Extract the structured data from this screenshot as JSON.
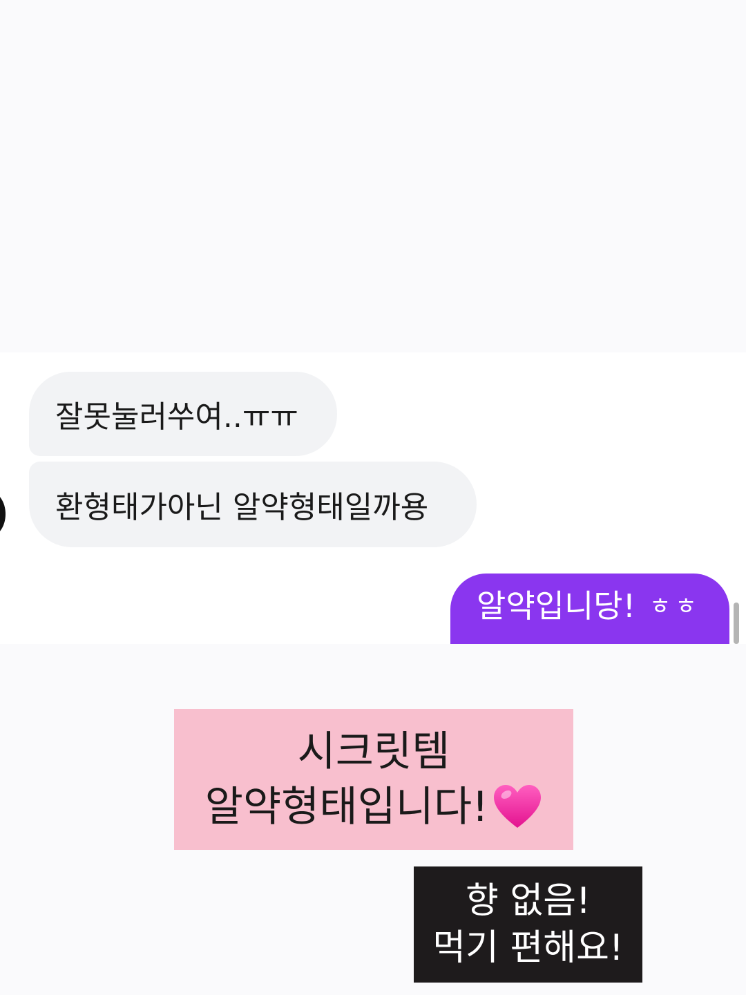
{
  "chat": {
    "messages": [
      {
        "side": "incoming",
        "text": "잘못눌러쑤여..ㅠㅠ"
      },
      {
        "side": "incoming",
        "text": "환형태가아닌 알약형태일까용"
      },
      {
        "side": "outgoing",
        "text": "알약입니당!",
        "laugh": "ㅎㅎ"
      }
    ],
    "colors": {
      "incoming_bubble": "#f2f3f5",
      "outgoing_bubble": "#8a36ef"
    }
  },
  "captions": {
    "pink": {
      "line1": "시크릿템",
      "line2": "알약형태입니다!",
      "icon": "pink-heart-icon",
      "background": "#f8bfce"
    },
    "dark": {
      "line1": "향 없음!",
      "line2": "먹기 편해요!",
      "background": "#1e1b1c"
    }
  }
}
